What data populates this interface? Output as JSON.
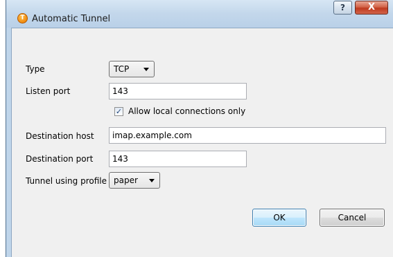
{
  "window": {
    "title": "Automatic Tunnel",
    "help_label": "?",
    "close_label": "X"
  },
  "form": {
    "type_label": "Type",
    "type_value": "TCP",
    "listen_port_label": "Listen port",
    "listen_port_value": "143",
    "allow_local_label": "Allow local connections only",
    "allow_local_checked": true,
    "destination_host_label": "Destination host",
    "destination_host_value": "imap.example.com",
    "destination_port_label": "Destination port",
    "destination_port_value": "143",
    "profile_label": "Tunnel using profile",
    "profile_value": "paper"
  },
  "buttons": {
    "ok_label": "OK",
    "cancel_label": "Cancel"
  },
  "colors": {
    "titlebar": "#c3d7eb",
    "dialog_background": "#f0f0f0",
    "close_button": "#c84b31",
    "default_button_border": "#3c7fb1"
  }
}
